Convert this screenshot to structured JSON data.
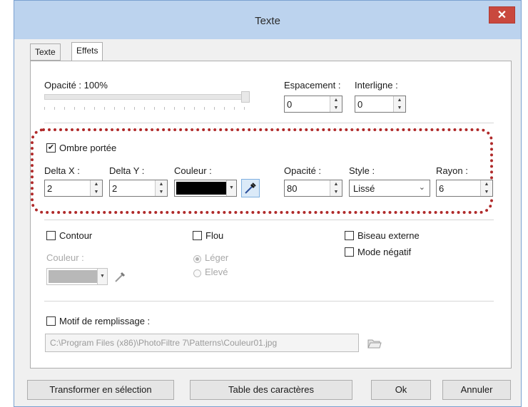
{
  "window": {
    "title": "Texte",
    "close_symbol": "✕"
  },
  "tabs": [
    {
      "label": "Texte"
    },
    {
      "label": "Effets"
    }
  ],
  "opacity_section": {
    "label": "Opacité : 100%",
    "level": 1.0,
    "spacing_label": "Espacement :",
    "spacing_value": "0",
    "line_spacing_label": "Interligne :",
    "line_spacing_value": "0"
  },
  "shadow": {
    "checkbox_label": "Ombre portée",
    "checked": true,
    "delta_x_label": "Delta X :",
    "delta_x_value": "2",
    "delta_y_label": "Delta Y :",
    "delta_y_value": "2",
    "color_label": "Couleur :",
    "color_value": "#000000",
    "opacity_label": "Opacité :",
    "opacity_value": "80",
    "style_label": "Style :",
    "style_value": "Lissé",
    "radius_label": "Rayon :",
    "radius_value": "6",
    "highlight_color": "#b02a2a"
  },
  "effects": {
    "contour_label": "Contour",
    "flou_label": "Flou",
    "biseau_label": "Biseau externe",
    "negatif_label": "Mode négatif",
    "couleur_label": "Couleur :",
    "contour_color": "#b8b8b8",
    "leger_label": "Léger",
    "eleve_label": "Elevé"
  },
  "pattern": {
    "checkbox_label": "Motif de remplissage :",
    "path": "C:\\Program Files (x86)\\PhotoFiltre 7\\Patterns\\Couleur01.jpg"
  },
  "buttons": {
    "transform": "Transformer en sélection",
    "char_table": "Table des caractères",
    "ok": "Ok",
    "cancel": "Annuler"
  },
  "icons": {
    "close": "close-icon",
    "eyedropper": "eyedropper-icon",
    "folder": "folder-open-icon"
  }
}
